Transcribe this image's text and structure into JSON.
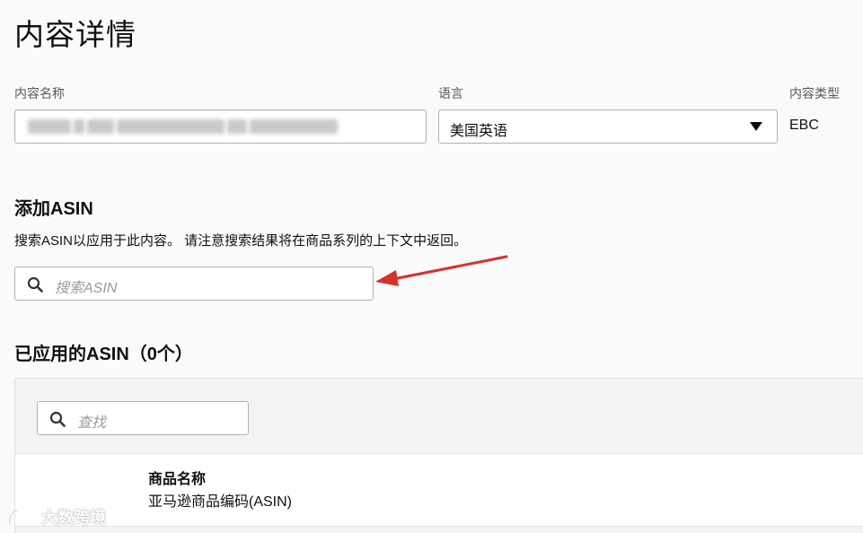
{
  "page": {
    "title": "内容详情"
  },
  "fields": {
    "name_label": "内容名称",
    "language_label": "语言",
    "language_value": "美国英语",
    "type_label": "内容类型",
    "type_value": "EBC"
  },
  "add_asin": {
    "heading": "添加ASIN",
    "description": "搜索ASIN以应用于此内容。 请注意搜索结果将在商品系列的上下文中返回。",
    "search_placeholder": "搜索ASIN"
  },
  "applied_asin": {
    "heading": "已应用的ASIN（0个）",
    "search_placeholder": "查找",
    "columns": [
      {
        "title": "商品名称",
        "subtitle": "亚马逊商品编码(ASIN)"
      }
    ]
  },
  "annotation": {
    "arrow_color": "#d9302c"
  },
  "watermark": {
    "text": "大数跨境"
  },
  "icons": {
    "search": "search-icon",
    "dropdown": "caret-down-icon",
    "annotation": "arrow-icon"
  }
}
